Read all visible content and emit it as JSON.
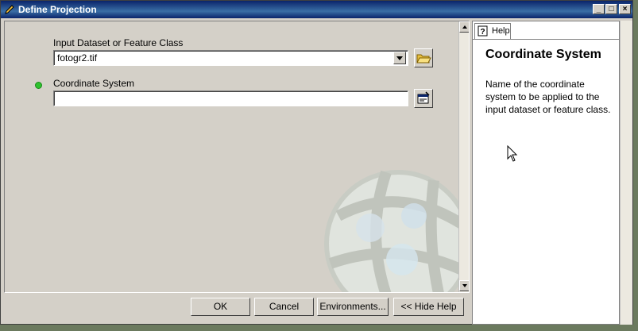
{
  "window": {
    "title": "Define Projection",
    "controls": {
      "minimize": "_",
      "maximize": "□",
      "close": "×"
    }
  },
  "form": {
    "input_dataset": {
      "label": "Input Dataset or Feature Class",
      "value": "fotogr2.tif"
    },
    "coordinate_system": {
      "label": "Coordinate System",
      "value": ""
    }
  },
  "buttons": {
    "ok": "OK",
    "cancel": "Cancel",
    "environments": "Environments...",
    "hide_help": "<< Hide Help"
  },
  "help": {
    "tab_label": "Help",
    "title": "Coordinate System",
    "description": "Name of the coordinate system to be applied to the input dataset or feature class."
  },
  "icons": {
    "title": "pencil-icon",
    "open_folder": "open-folder-icon",
    "properties": "properties-icon",
    "help": "help-icon",
    "required": "required-dot-icon"
  },
  "colors": {
    "title_bar": "#0a246a",
    "required_dot": "#2ec22e",
    "dialog_bg": "#d4d0c8"
  }
}
